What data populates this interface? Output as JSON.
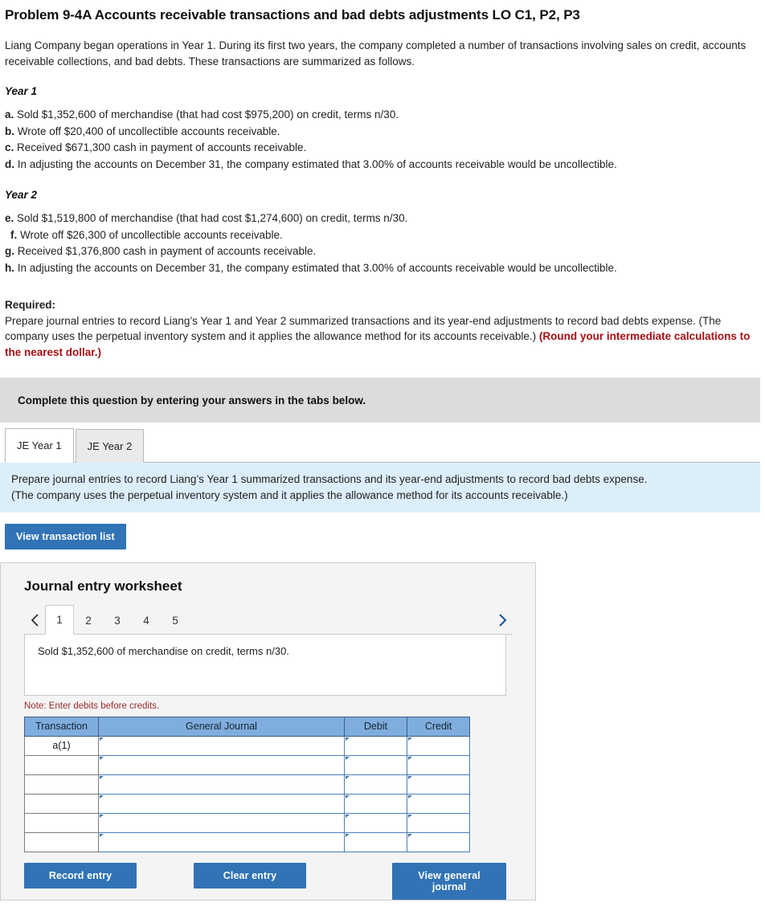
{
  "problem": {
    "title": "Problem 9-4A Accounts receivable transactions and bad debts adjustments LO C1, P2, P3",
    "intro": "Liang Company began operations in Year 1. During its first two years, the company completed a number of transactions involving sales on credit, accounts receivable collections, and bad debts. These transactions are summarized as follows.",
    "year1_heading": "Year 1",
    "year1_items": [
      {
        "label": "a.",
        "text": "Sold $1,352,600 of merchandise (that had cost $975,200) on credit, terms n/30."
      },
      {
        "label": "b.",
        "text": "Wrote off $20,400 of uncollectible accounts receivable."
      },
      {
        "label": "c.",
        "text": "Received $671,300 cash in payment of accounts receivable."
      },
      {
        "label": "d.",
        "text": "In adjusting the accounts on December 31, the company estimated that 3.00% of accounts receivable would be uncollectible."
      }
    ],
    "year2_heading": "Year 2",
    "year2_items": [
      {
        "label": "e.",
        "text": "Sold $1,519,800 of merchandise (that had cost $1,274,600) on credit, terms n/30."
      },
      {
        "label": "f.",
        "text": "Wrote off $26,300 of uncollectible accounts receivable."
      },
      {
        "label": "g.",
        "text": "Received $1,376,800 cash in payment of accounts receivable."
      },
      {
        "label": "h.",
        "text": "In adjusting the accounts on December 31, the company estimated that 3.00% of accounts receivable would be uncollectible."
      }
    ],
    "required_label": "Required:",
    "required_text": "Prepare journal entries to record Liang’s Year 1 and Year 2 summarized transactions and its year-end adjustments to record bad debts expense. (The company uses the perpetual inventory system and it applies the allowance method for its accounts receivable.) ",
    "required_emphasis": "(Round your intermediate calculations to the nearest dollar.)"
  },
  "banner": {
    "text": "Complete this question by entering your answers in the tabs below."
  },
  "tabs": [
    {
      "label": "JE Year 1",
      "active": true
    },
    {
      "label": "JE Year 2",
      "active": false
    }
  ],
  "instruction": {
    "line1": "Prepare journal entries to record Liang’s Year 1 summarized transactions and its year-end adjustments to record bad debts expense.",
    "line2": "(The company uses the perpetual inventory system and it applies the allowance method for its accounts receivable.)"
  },
  "toolbar": {
    "view_transaction_list": "View transaction list"
  },
  "worksheet": {
    "title": "Journal entry worksheet",
    "pager": {
      "prev_icon": "chevron-left-icon",
      "next_icon": "chevron-right-icon",
      "pages": [
        "1",
        "2",
        "3",
        "4",
        "5"
      ],
      "active_page": "1"
    },
    "description": "Sold $1,352,600 of merchandise on credit, terms n/30.",
    "note": "Note: Enter debits before credits.",
    "table": {
      "headers": [
        "Transaction",
        "General Journal",
        "Debit",
        "Credit"
      ],
      "rows": [
        {
          "transaction": "a(1)",
          "general_journal": "",
          "debit": "",
          "credit": ""
        },
        {
          "transaction": "",
          "general_journal": "",
          "debit": "",
          "credit": ""
        },
        {
          "transaction": "",
          "general_journal": "",
          "debit": "",
          "credit": ""
        },
        {
          "transaction": "",
          "general_journal": "",
          "debit": "",
          "credit": ""
        },
        {
          "transaction": "",
          "general_journal": "",
          "debit": "",
          "credit": ""
        },
        {
          "transaction": "",
          "general_journal": "",
          "debit": "",
          "credit": ""
        }
      ]
    },
    "buttons": {
      "record_entry": "Record entry",
      "clear_entry": "Clear entry",
      "view_general_journal": "View general journal"
    }
  },
  "colors": {
    "button_blue": "#3173b5",
    "table_header_blue": "#7fadde",
    "instruction_panel_blue": "#ddeefb",
    "banner_gray": "#dcdcdc",
    "note_red": "#9a2b2b",
    "emphasis_red": "#a60f14"
  }
}
